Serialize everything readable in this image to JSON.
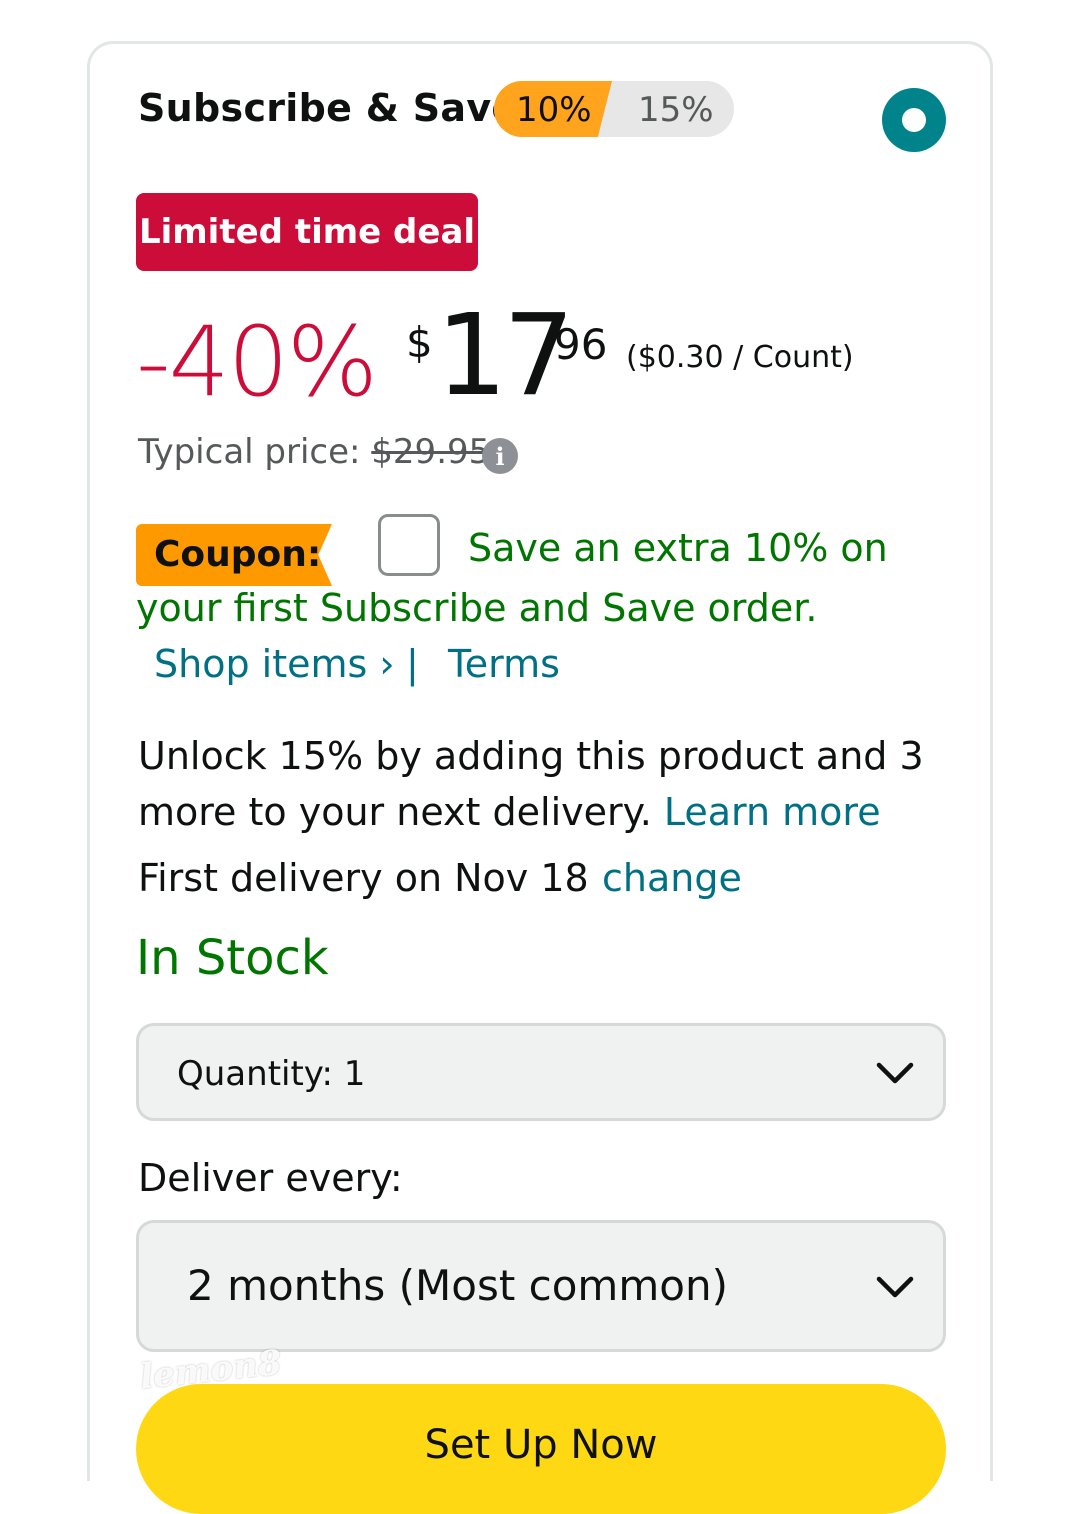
{
  "subscribe": {
    "title": "Subscribe & Save:",
    "tier_1": "10%",
    "tier_2": "15%",
    "selected": true
  },
  "deal_badge": "Limited time deal",
  "price": {
    "discount": "-40%",
    "currency": "$",
    "whole": "17",
    "cents": "96",
    "unit_price": "($0.30 / Count)",
    "typical_label": "Typical price: ",
    "typical_value": "$29.95"
  },
  "coupon": {
    "label": "Coupon:",
    "text_line1": "Save an extra 10% on",
    "text_line2": "your first Subscribe and Save order.",
    "shop_items": "Shop items ›",
    "separator": "|",
    "terms": "Terms",
    "checked": false
  },
  "unlock": {
    "line1": "Unlock 15% by adding this product and 3",
    "line2": "more to your next delivery. ",
    "learn_more": "Learn more"
  },
  "delivery": {
    "first_delivery": "First delivery on Nov 18",
    "change": "change"
  },
  "stock_status": "In Stock",
  "quantity": {
    "label": "Quantity:  1"
  },
  "deliver_every": {
    "label": "Deliver every:",
    "value": "2 months (Most common)"
  },
  "setup_button": "Set Up Now",
  "watermark": "lemon8",
  "colors": {
    "accent_orange": "#ffa41c",
    "deal_red": "#cc0c39",
    "link_teal": "#007185",
    "stock_green": "#007600",
    "button_yellow": "#ffd814"
  }
}
